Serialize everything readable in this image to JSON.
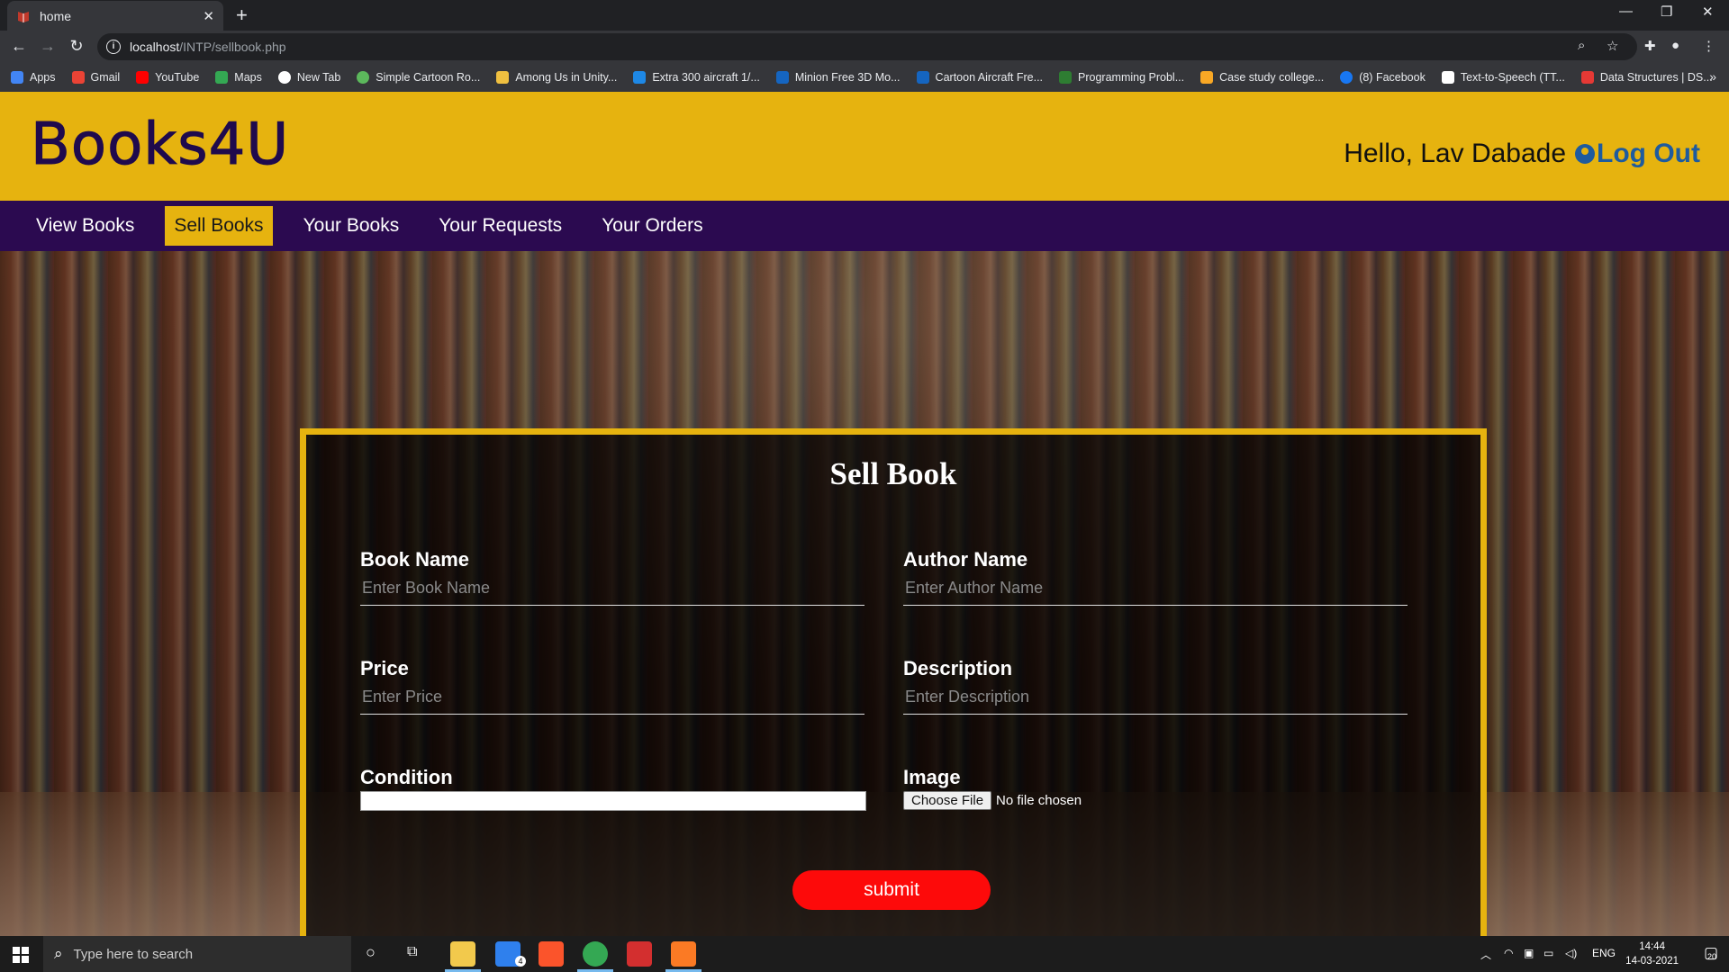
{
  "browser": {
    "tab_title": "home",
    "new_tab": "+",
    "url_host": "localhost",
    "url_path": "/INTP/sellbook.php",
    "bookmarks": [
      {
        "label": "Apps",
        "color": "#4285f4"
      },
      {
        "label": "Gmail",
        "color": "#ea4335"
      },
      {
        "label": "YouTube",
        "color": "#ff0000"
      },
      {
        "label": "Maps",
        "color": "#34a853"
      },
      {
        "label": "New Tab",
        "color": "#ffffff"
      },
      {
        "label": "Simple Cartoon Ro...",
        "color": "#5cb85c"
      },
      {
        "label": "Among Us in Unity...",
        "color": "#f0c040"
      },
      {
        "label": "Extra 300 aircraft 1/...",
        "color": "#1e88e5"
      },
      {
        "label": "Minion Free 3D Mo...",
        "color": "#1565c0"
      },
      {
        "label": "Cartoon Aircraft Fre...",
        "color": "#1565c0"
      },
      {
        "label": "Programming Probl...",
        "color": "#2e7d32"
      },
      {
        "label": "Case study college...",
        "color": "#f9a825"
      },
      {
        "label": "(8) Facebook",
        "color": "#1877f2"
      },
      {
        "label": "Text-to-Speech (TT...",
        "color": "#ffffff"
      },
      {
        "label": "Data Structures | DS...",
        "color": "#e53935"
      }
    ]
  },
  "site": {
    "logo": "Books4U",
    "greeting": "Hello, Lav Dabade",
    "logout": "Log Out",
    "nav": [
      "View Books",
      "Sell Books",
      "Your Books",
      "Your Requests",
      "Your Orders"
    ],
    "active_nav": "Sell Books",
    "accent": "#e6b30f",
    "nav_bg": "#2b0a50"
  },
  "form": {
    "title": "Sell Book",
    "book_name": {
      "label": "Book Name",
      "placeholder": "Enter Book Name"
    },
    "author_name": {
      "label": "Author Name",
      "placeholder": "Enter Author Name"
    },
    "price": {
      "label": "Price",
      "placeholder": "Enter Price"
    },
    "description": {
      "label": "Description",
      "placeholder": "Enter Description"
    },
    "condition": {
      "label": "Condition",
      "value": ""
    },
    "image": {
      "label": "Image",
      "button": "Choose File",
      "status": "No file chosen"
    },
    "submit": "submit"
  },
  "taskbar": {
    "search_placeholder": "Type here to search",
    "lang": "ENG",
    "time": "14:44",
    "date": "14-03-2021",
    "notifications": "20",
    "mail_badge": "4"
  }
}
